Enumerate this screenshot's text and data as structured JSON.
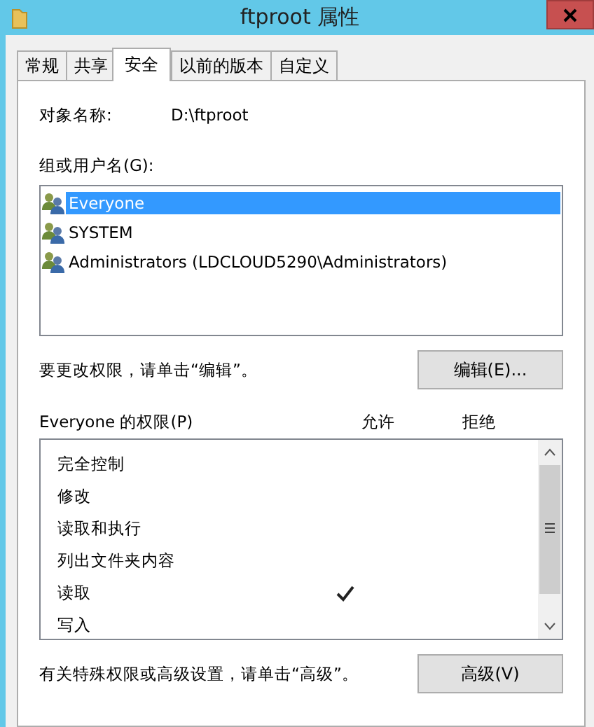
{
  "window": {
    "title": "ftproot 属性"
  },
  "tabs": [
    {
      "label": "常规",
      "selected": false
    },
    {
      "label": "共享",
      "selected": false
    },
    {
      "label": "安全",
      "selected": true
    },
    {
      "label": "以前的版本",
      "selected": false
    },
    {
      "label": "自定义",
      "selected": false
    }
  ],
  "object_name": {
    "label": "对象名称:",
    "value": "D:\\ftproot"
  },
  "groups": {
    "label": "组或用户名(G):",
    "items": [
      {
        "name": "Everyone",
        "selected": true
      },
      {
        "name": "SYSTEM",
        "selected": false
      },
      {
        "name": "Administrators (LDCLOUD5290\\Administrators)",
        "selected": false
      }
    ]
  },
  "edit_hint": "要更改权限，请单击“编辑”。",
  "edit_button": "编辑(E)...",
  "permissions": {
    "title": "Everyone 的权限(P)",
    "allow_header": "允许",
    "deny_header": "拒绝",
    "rows": [
      {
        "name": "完全控制",
        "allow": false,
        "deny": false
      },
      {
        "name": "修改",
        "allow": false,
        "deny": false
      },
      {
        "name": "读取和执行",
        "allow": false,
        "deny": false
      },
      {
        "name": "列出文件夹内容",
        "allow": false,
        "deny": false
      },
      {
        "name": "读取",
        "allow": true,
        "deny": false
      },
      {
        "name": "写入",
        "allow": false,
        "deny": false
      }
    ]
  },
  "advanced_hint": "有关特殊权限或高级设置，请单击“高级”。",
  "advanced_button": "高级(V)"
}
